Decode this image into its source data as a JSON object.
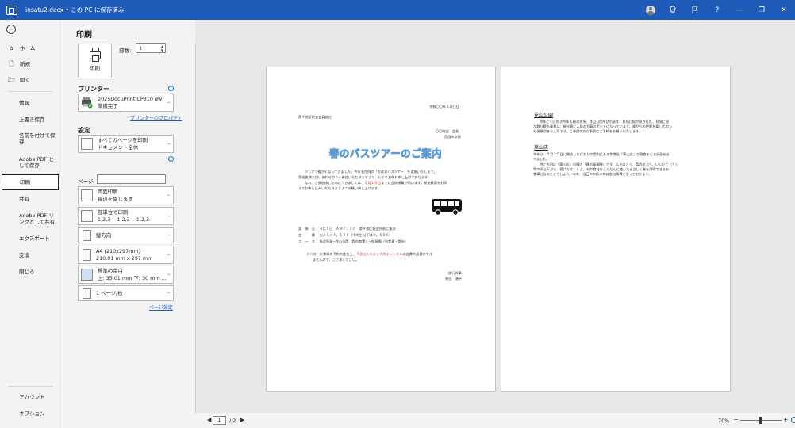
{
  "titlebar": {
    "title": "insatu2.docx • この PC に保存済み",
    "icons": [
      "account-avatar-icon",
      "lightbulb-icon",
      "feedback-icon",
      "help-icon",
      "minimize-icon",
      "restore-icon",
      "close-icon"
    ],
    "help": "?",
    "minimize": "—",
    "restore": "❐",
    "close": "✕"
  },
  "nav": {
    "top": [
      {
        "label": "ホーム",
        "icon": "home-icon",
        "glyph": "⌂"
      },
      {
        "label": "新規",
        "icon": "new-document-icon",
        "glyph": "🗋"
      },
      {
        "label": "開く",
        "icon": "open-folder-icon",
        "glyph": "🗁"
      }
    ],
    "items": [
      "情報",
      "上書き保存",
      "名前を付けて保存",
      "Adobe PDF として保存",
      "印刷",
      "共有",
      "Adobe PDF リンクとして共有",
      "エクスポート",
      "変換",
      "閉じる"
    ],
    "bottom": [
      "アカウント",
      "オプション"
    ]
  },
  "panel": {
    "title": "印刷",
    "print_button": "印刷",
    "copies_label": "部数:",
    "copies_value": "1",
    "printer_title": "プリンター",
    "printer_name": "2025DocuPrint CP310 dw",
    "printer_status": "準備完了",
    "printer_props_link": "プリンターのプロパティ",
    "settings_title": "設定",
    "range_line1": "すべてのページを印刷",
    "range_line2": "ドキュメント全体",
    "pages_label": "ページ:",
    "pages_value": "",
    "duplex_line1": "両面印刷",
    "duplex_line2": "長辺を綴じます",
    "collate_line1": "部単位で印刷",
    "collate_line2": "1,2,3    1,2,3    1,2,3",
    "orientation": "縦方向",
    "paper_line1": "A4 (210x297mm)",
    "paper_line2": "210.01 mm x 297 mm",
    "margins_line1": "標準の余白",
    "margins_line2": "上: 35.01 mm 下: 30 mm ...",
    "pps": "1 ページ/枚",
    "page_setup_link": "ページ設定"
  },
  "preview": {
    "page1": {
      "date": "令和〇〇年３月〇日",
      "to": "第４地区町会会員各位",
      "from1": "〇〇町会　会長",
      "from2": "西国幸次郎",
      "headline": "春のバスツアーのご案内",
      "body1": "少しずつ暖かくなってきました。今年も恒例の「お花見バスツアー」を実施いたします。",
      "body2": "家族皆様お誘いあわせのうえ参加いただきますよう、心よりお待ち申し上げております。",
      "body3_a": "なお、ご参加申し込みにつきましては、",
      "body3_red": "３月１０日",
      "body3_b": "までに会計係員が伺います。参加費用をお添",
      "body4": "えてお申し込みいただきますようお願い申し上げます。",
      "d1": "実　施　日　 ４月５日　ＡＭ７：３０　第４地区集会所前に集合",
      "d2": "会　　　費　 大人１人４，５００（中学生以下は３，５００）",
      "d3": "コ　ー　ス　 集会所発→花山公園（園内散策）→桃源郷（旬食事・散歩）",
      "note_a": "※バス・お食事の予約の都合上、",
      "note_red": "４月に入りましてのキャンセル",
      "note_b": "は会費の返還ができ",
      "note2": "ませんので、ご了承ください。",
      "sign1": "旅行幹事",
      "sign2": "柴田　湧子"
    },
    "page2": {
      "head1": "花山公園",
      "p1_1": "昨年に引き続き今年も桜の名所、花山公園を訪れます。見頃に桜が咲き乱れ、見頃に桜",
      "p1_2": "が散り敷る風景は、観光客に人気の写真スポットになっています。傘からの絶景を楽しむのも",
      "p1_3": "も風情があり人気です。ご希望の方は事前にご予約をお願いいたします。",
      "head2": "華山店",
      "p2_1": "今年は、３月２５日に開店したばかりの園内にある和食処「華山店」で昼食をとる計画をま",
      "p2_2": "てました。",
      "p2_3": "特に今回は「華山店」自慢の「春の風御膳」です。ふきのとう、菜の花ぷら、いいだこ（？）、",
      "p2_4": "筍の子と天ぷら（揚げたて？）と、旬の食材をふんだんに使ったまさしく春を満喫できるお",
      "p2_5": "食事となることでしょう。なお、当日のお飲み物は各自実費となっております。"
    }
  },
  "bottombar": {
    "current_page": "1",
    "page_total": "/ 2",
    "zoom": "70%",
    "minus": "−",
    "plus": "+"
  }
}
